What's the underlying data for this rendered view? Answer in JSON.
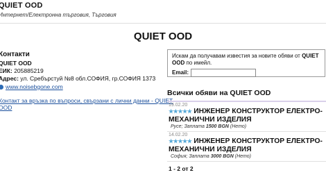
{
  "header": {
    "company": "QUIET OOD",
    "category": "Интернет/Електронна търговия, Търговия"
  },
  "page_title": "QUIET OOD",
  "contacts": {
    "heading": "Контакти",
    "name": "QUIET OOD",
    "eik_label": "ЕИК:",
    "eik_value": "205885219",
    "address_label": "Адрес:",
    "address_value": "ул. Сребърстуй №8 обл.СОФИЯ, гр.СОФИЯ 1373",
    "website": "www.noisebgone.com",
    "privacy_link_line1": "Контакт за връзка по въпроси, свързани с лични данни - QUIET",
    "privacy_link_line2": "OOD"
  },
  "notify_box": {
    "text_before": "Искам да получавам известия за новите обяви от",
    "company": "QUIET OOD",
    "text_after": "по имейл.",
    "email_label": "Email:",
    "email_value": ""
  },
  "ads": {
    "heading": "Всички обяви на QUIET OOD",
    "items": [
      {
        "date": "19.02.20",
        "stars": "★★★★★",
        "title_line1": "ИНЖЕНЕР КОНСТРУКТОР ЕЛЕКТРО-",
        "title_line2": "МЕХАНИЧНИ ИЗДЕЛИЯ",
        "city": "Русе;",
        "salary_label": "Заплата",
        "salary": "1500 BGN",
        "salary_type": "(Нето)"
      },
      {
        "date": "14.02.20",
        "stars": "★★★★★",
        "title_line1": "ИНЖЕНЕР КОНСТРУКТОР ЕЛЕКТРО-",
        "title_line2": "МЕХАНИЧНИ ИЗДЕЛИЯ",
        "city": "София;",
        "salary_label": "Заплата",
        "salary": "3000 BGN",
        "salary_type": "(Нето)"
      }
    ],
    "pager": "1 - 2 от 2"
  }
}
